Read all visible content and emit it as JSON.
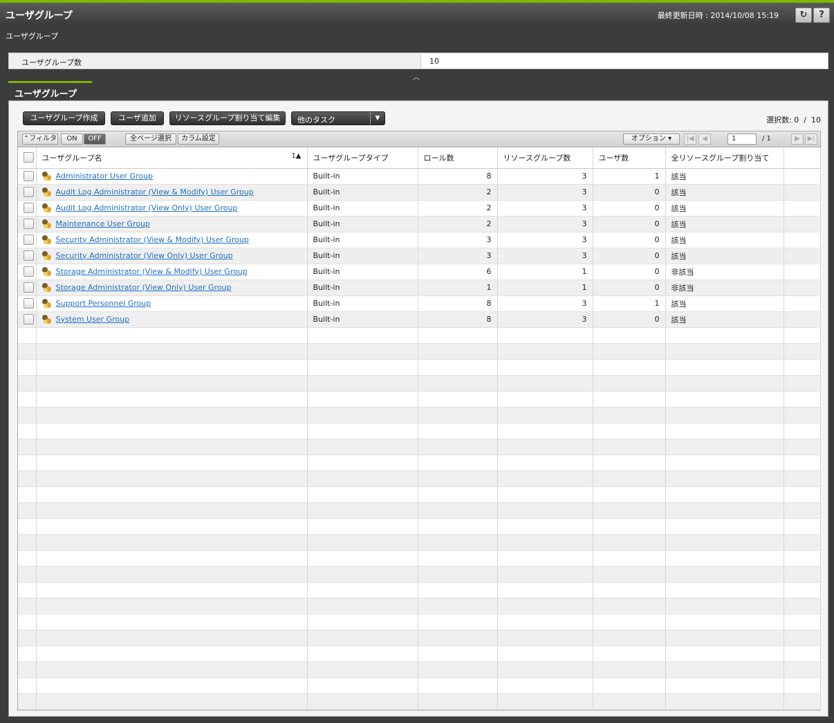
{
  "header": {
    "title": "ユーザグループ",
    "last_updated_label": "最終更新日時",
    "last_updated_value": "2014/10/08 15:19"
  },
  "breadcrumb": "ユーザグループ",
  "summary": {
    "label": "ユーザグループ数",
    "value": "10"
  },
  "tab": "ユーザグループ",
  "actions": {
    "create_group": "ユーザグループ作成",
    "add_user": "ユーザ追加",
    "edit_resource_groups": "リソースグループ割り当て編集",
    "other_tasks": "他のタスク"
  },
  "selection": {
    "label": "選択数",
    "selected": "0",
    "separator": "/",
    "total": "10"
  },
  "toolbar": {
    "filter": "フィルタ",
    "on": "ON",
    "off": "OFF",
    "select_all_pages": "全ページ選択",
    "column_settings": "カラム設定",
    "options": "オプション",
    "page_current": "1",
    "page_total": "/ 1"
  },
  "table": {
    "headers": [
      "ユーザグループ名",
      "ユーザグループタイプ",
      "ロール数",
      "リソースグループ数",
      "ユーザ数",
      "全リソースグループ割り当て"
    ],
    "sort_indicator": "1▲",
    "rows": [
      {
        "name": "Administrator User Group",
        "type": "Built-in",
        "roles": "8",
        "resource_groups": "3",
        "users": "1",
        "all_rg": "該当"
      },
      {
        "name": "Audit Log Administrator (View & Modify) User Group",
        "type": "Built-in",
        "roles": "2",
        "resource_groups": "3",
        "users": "0",
        "all_rg": "該当"
      },
      {
        "name": "Audit Log Administrator (View Only) User Group",
        "type": "Built-in",
        "roles": "2",
        "resource_groups": "3",
        "users": "0",
        "all_rg": "該当"
      },
      {
        "name": "Maintenance User Group",
        "type": "Built-in",
        "roles": "2",
        "resource_groups": "3",
        "users": "0",
        "all_rg": "該当"
      },
      {
        "name": "Security Administrator (View & Modify) User Group",
        "type": "Built-in",
        "roles": "3",
        "resource_groups": "3",
        "users": "0",
        "all_rg": "該当"
      },
      {
        "name": "Security Administrator (View Only) User Group",
        "type": "Built-in",
        "roles": "3",
        "resource_groups": "3",
        "users": "0",
        "all_rg": "該当"
      },
      {
        "name": "Storage Administrator (View & Modify) User Group",
        "type": "Built-in",
        "roles": "6",
        "resource_groups": "1",
        "users": "0",
        "all_rg": "非該当"
      },
      {
        "name": "Storage Administrator (View Only) User Group",
        "type": "Built-in",
        "roles": "1",
        "resource_groups": "1",
        "users": "0",
        "all_rg": "非該当"
      },
      {
        "name": "Support Personnel Group",
        "type": "Built-in",
        "roles": "8",
        "resource_groups": "3",
        "users": "1",
        "all_rg": "該当"
      },
      {
        "name": "System User Group",
        "type": "Built-in",
        "roles": "8",
        "resource_groups": "3",
        "users": "0",
        "all_rg": "該当"
      }
    ]
  }
}
